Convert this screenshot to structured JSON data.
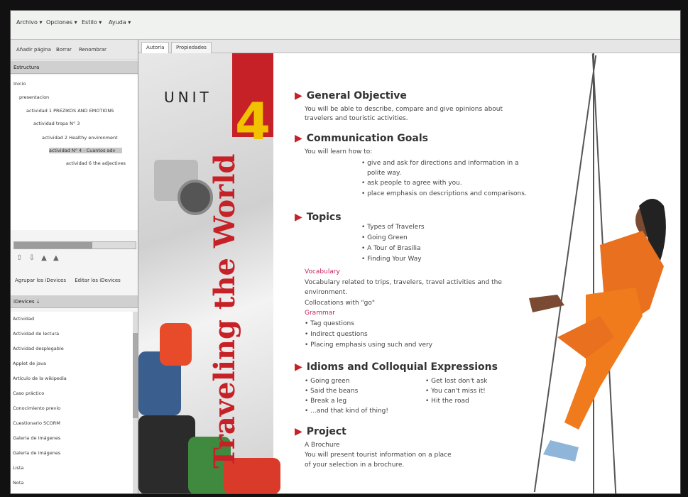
{
  "menubar": {
    "items": [
      "Archivo ▾",
      "Opciones ▾",
      "Estilo ▾",
      "Ayuda ▾"
    ]
  },
  "left_panel": {
    "toolbar": [
      "Añadir página",
      "Borrar",
      "Renombrar"
    ],
    "structure_header": "Estructura",
    "tree": [
      {
        "label": "Inicio",
        "indent": 0
      },
      {
        "label": "presentacion",
        "indent": 1
      },
      {
        "label": "actividad 1 PREZIKOS AND EMOTIONS",
        "indent": 2
      },
      {
        "label": "actividad tropa N° 3",
        "indent": 3
      },
      {
        "label": "actividad 2 Healthy environment",
        "indent": 4
      },
      {
        "label": "actividad N° 4 - Cuantos adv",
        "indent": 5
      },
      {
        "label": "actividad 6 the adjectives",
        "indent": 6
      }
    ],
    "buttons": [
      "Agrupar los iDevices",
      "Editar los iDevices"
    ],
    "idevices_header": "iDevices ⇣",
    "idevices": [
      "Actividad",
      "Actividad de lectura",
      "Actividad desplegable",
      "Applet de java",
      "Artículo de la wikipedia",
      "Caso práctico",
      "Conocimiento previo",
      "Cuestionario SCORM",
      "Galeria de imágenes",
      "Galería de imágenes",
      "Lista",
      "Nota"
    ]
  },
  "tabs": [
    "Autoría",
    "Propiedades"
  ],
  "page": {
    "unit_label": "UNIT",
    "unit_number": "4",
    "title": "Traveling the World",
    "sections": {
      "general_objective": {
        "heading": "General Objective",
        "lines": [
          "You will be able to describe, compare and give opinions about",
          "travelers and touristic activities."
        ]
      },
      "communication_goals": {
        "heading": "Communication Goals",
        "intro": "You will learn how to:",
        "bullets": [
          "give and ask for directions and information in a",
          "polite way.",
          "ask people to agree with you.",
          "place emphasis on descriptions and comparisons."
        ]
      },
      "topics": {
        "heading": "Topics",
        "bullets": [
          "Types of Travelers",
          "Going Green",
          "A Tour of Brasilia",
          "Finding Your Way"
        ],
        "vocab_label": "Vocabulary",
        "vocab_lines": [
          "Vocabulary related to trips, travelers, travel activities and the",
          "environment.",
          "Collocations with \"go\""
        ],
        "grammar_label": "Grammar",
        "grammar_bullets": [
          "Tag questions",
          "Indirect questions",
          "Placing emphasis using such and very"
        ]
      },
      "idioms": {
        "heading": "Idioms and Colloquial Expressions",
        "col1": [
          "Going green",
          "Said the beans",
          "Break a leg",
          "...and that kind of thing!"
        ],
        "col2": [
          "Get lost don't ask",
          "You can't miss it!",
          "Hit the road"
        ]
      },
      "project": {
        "heading": "Project",
        "lines": [
          "A Brochure",
          "You will present tourist information on a place",
          "of your selection in a brochure."
        ]
      }
    }
  }
}
